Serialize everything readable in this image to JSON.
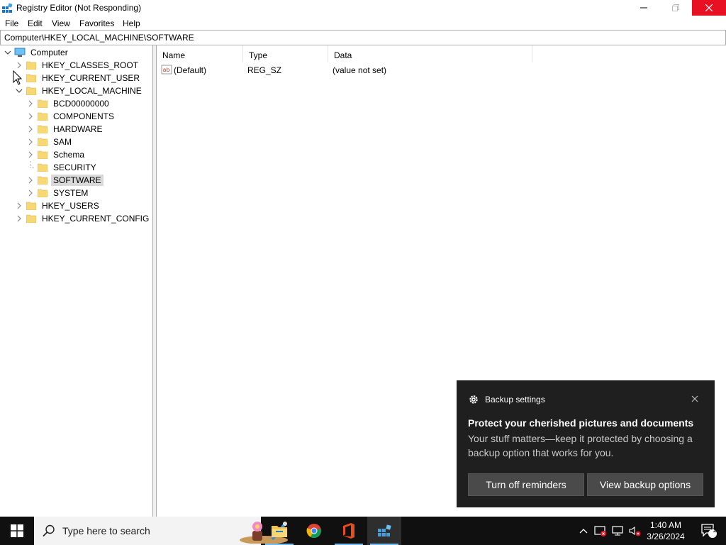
{
  "window": {
    "title": "Registry Editor (Not Responding)"
  },
  "menubar": {
    "items": [
      "File",
      "Edit",
      "View",
      "Favorites",
      "Help"
    ]
  },
  "address": {
    "path": "Computer\\HKEY_LOCAL_MACHINE\\SOFTWARE"
  },
  "tree": {
    "root": "Computer",
    "hives": {
      "classes_root": "HKEY_CLASSES_ROOT",
      "current_user": "HKEY_CURRENT_USER",
      "local_machine": "HKEY_LOCAL_MACHINE",
      "users": "HKEY_USERS",
      "current_config": "HKEY_CURRENT_CONFIG"
    },
    "hklm_children": [
      "BCD00000000",
      "COMPONENTS",
      "HARDWARE",
      "SAM",
      "Schema",
      "SECURITY",
      "SOFTWARE",
      "SYSTEM"
    ],
    "selected": "SOFTWARE"
  },
  "values_list": {
    "columns": [
      "Name",
      "Type",
      "Data"
    ],
    "rows": [
      {
        "name": "(Default)",
        "type": "REG_SZ",
        "data": "(value not set)"
      }
    ]
  },
  "toast": {
    "app_name": "Backup settings",
    "heading": "Protect your cherished pictures and documents",
    "body": "Your stuff matters—keep it protected by choosing a backup option that works for you.",
    "button_primary": "Turn off reminders",
    "button_secondary": "View backup options"
  },
  "taskbar": {
    "search_placeholder": "Type here to search",
    "time": "1:40 AM",
    "date": "3/26/2024",
    "notification_count": "1"
  },
  "colors": {
    "accent": "#0078d7",
    "close_red": "#e81123",
    "folder_yellow": "#f8d775",
    "taskbar_bg": "#101010",
    "toast_bg": "#1f1f1f"
  }
}
